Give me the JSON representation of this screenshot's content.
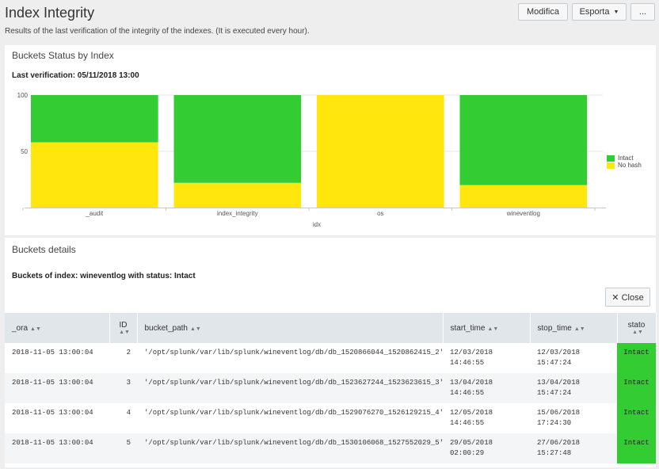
{
  "header": {
    "title": "Index Integrity",
    "description": "Results of the last verification of the integrity of the indexes. (It is executed every hour).",
    "edit_label": "Modifica",
    "export_label": "Esporta",
    "more_label": "..."
  },
  "chart_panel": {
    "title": "Buckets Status by Index",
    "subtitle": "Last verification: 05/11/2018 13:00"
  },
  "colors": {
    "intact": "#33cc33",
    "no_hash": "#ffe70d"
  },
  "chart_data": {
    "type": "bar",
    "stacked": true,
    "categories": [
      "_audit",
      "index_integrity",
      "os",
      "wineventlog"
    ],
    "series": [
      {
        "name": "No hash",
        "values": [
          58,
          22,
          100,
          20
        ]
      },
      {
        "name": "Intact",
        "values": [
          42,
          78,
          0,
          80
        ]
      }
    ],
    "xlabel": "idx",
    "ylabel": "",
    "ylim": [
      0,
      100
    ],
    "yticks": [
      50,
      100
    ],
    "legend": [
      "Intact",
      "No hash"
    ],
    "legend_position": "right"
  },
  "details_panel": {
    "title": "Buckets details",
    "subtitle": "Buckets of index: wineventlog with status: Intact",
    "close_label": "✕ Close",
    "columns": {
      "ora": "_ora",
      "id": "ID",
      "bucket_path": "bucket_path",
      "start_time": "start_time",
      "stop_time": "stop_time",
      "stato": "stato"
    },
    "rows": [
      {
        "ora": "2018-11-05 13:00:04",
        "id": "2",
        "bucket_path": "'/opt/splunk/var/lib/splunk/wineventlog/db/db_1520866044_1520862415_2'",
        "start_date": "12/03/2018",
        "start_hour": "14:46:55",
        "stop_date": "12/03/2018",
        "stop_hour": "15:47:24",
        "stato": "Intact"
      },
      {
        "ora": "2018-11-05 13:00:04",
        "id": "3",
        "bucket_path": "'/opt/splunk/var/lib/splunk/wineventlog/db/db_1523627244_1523623615_3'",
        "start_date": "13/04/2018",
        "start_hour": "14:46:55",
        "stop_date": "13/04/2018",
        "stop_hour": "15:47:24",
        "stato": "Intact"
      },
      {
        "ora": "2018-11-05 13:00:04",
        "id": "4",
        "bucket_path": "'/opt/splunk/var/lib/splunk/wineventlog/db/db_1529076270_1526129215_4'",
        "start_date": "12/05/2018",
        "start_hour": "14:46:55",
        "stop_date": "15/06/2018",
        "stop_hour": "17:24:30",
        "stato": "Intact"
      },
      {
        "ora": "2018-11-05 13:00:04",
        "id": "5",
        "bucket_path": "'/opt/splunk/var/lib/splunk/wineventlog/db/db_1530106068_1527552029_5'",
        "start_date": "29/05/2018",
        "start_hour": "02:00:29",
        "stop_date": "27/06/2018",
        "stop_hour": "15:27:48",
        "stato": "Intact"
      }
    ]
  }
}
